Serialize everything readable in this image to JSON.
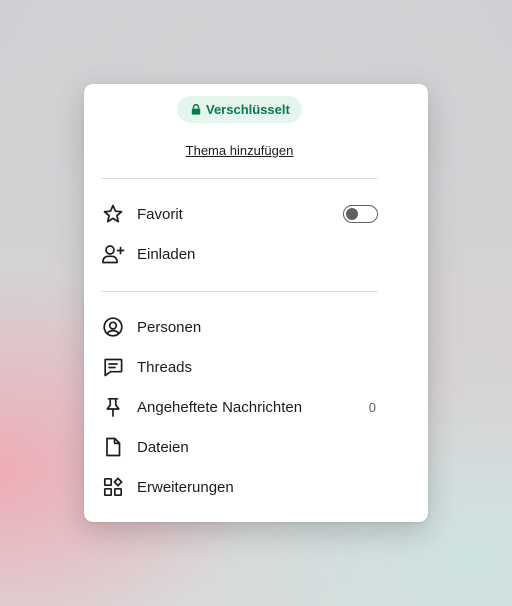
{
  "header": {
    "badge_label": "Verschlüsselt",
    "add_topic_label": "Thema hinzufügen"
  },
  "section_primary": {
    "items": [
      {
        "label": "Favorit",
        "icon": "star-icon",
        "toggle_on": false
      },
      {
        "label": "Einladen",
        "icon": "add-person-icon"
      }
    ]
  },
  "section_secondary": {
    "items": [
      {
        "label": "Personen",
        "icon": "person-circle-icon"
      },
      {
        "label": "Threads",
        "icon": "threads-icon"
      },
      {
        "label": "Angeheftete Nachrichten",
        "icon": "pin-icon",
        "count": "0"
      },
      {
        "label": "Dateien",
        "icon": "file-icon"
      },
      {
        "label": "Erweiterungen",
        "icon": "apps-icon"
      }
    ]
  },
  "colors": {
    "badge_bg": "#e3f5ec",
    "badge_text": "#0b7a4b",
    "text": "#1d1c1d",
    "muted": "#616061"
  }
}
